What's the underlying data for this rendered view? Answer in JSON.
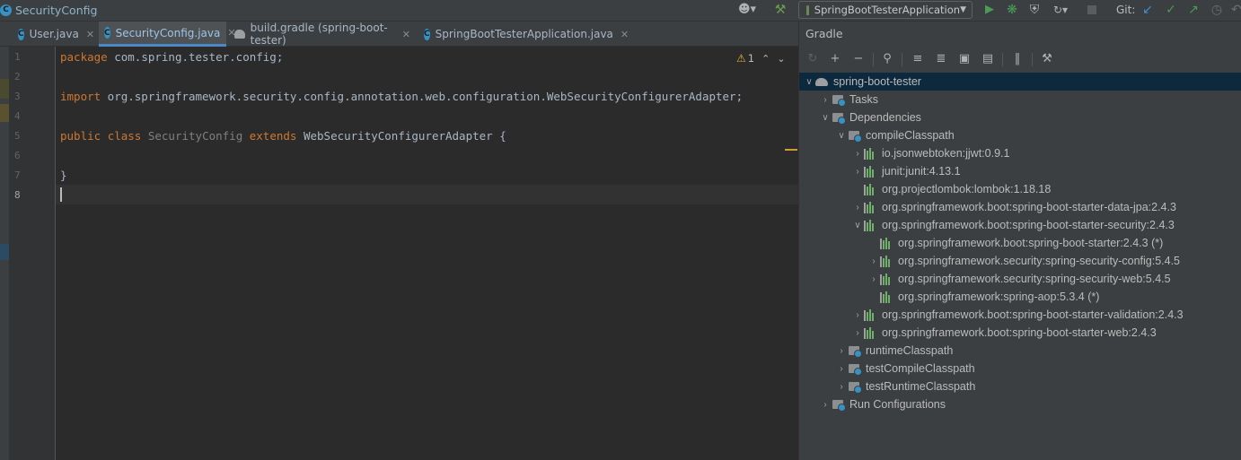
{
  "window": {
    "breadcrumb": "SecurityConfig"
  },
  "toolbar": {
    "run_config": "SpringBootTesterApplication",
    "git_label": "Git:"
  },
  "tabs": [
    {
      "label": "User.java",
      "icon": "java-class-icon"
    },
    {
      "label": "SecurityConfig.java",
      "icon": "java-class-icon",
      "active": true
    },
    {
      "label": "build.gradle (spring-boot-tester)",
      "icon": "gradle-icon"
    },
    {
      "label": "SpringBootTesterApplication.java",
      "icon": "java-class-icon"
    }
  ],
  "editor": {
    "line_numbers": [
      "1",
      "2",
      "3",
      "4",
      "5",
      "6",
      "7",
      "8"
    ],
    "current_line": "8",
    "inspection": {
      "warnings": "1"
    },
    "lines": {
      "l1": {
        "kw": "package",
        "rest": " com.spring.tester.config;"
      },
      "l3": {
        "kw": "import",
        "rest": " org.springframework.security.config.annotation.web.configuration.WebSecurityConfigurerAdapter;"
      },
      "l5": {
        "kw1": "public",
        "kw2": "class",
        "name": "SecurityConfig",
        "kw3": "extends",
        "parent": "WebSecurityConfigurerAdapter",
        "brace": "{"
      },
      "l7": {
        "brace": "}"
      }
    }
  },
  "gradle": {
    "title": "Gradle",
    "tree": [
      {
        "label": "spring-boot-tester"
      },
      {
        "label": "Tasks"
      },
      {
        "label": "Dependencies"
      },
      {
        "label": "compileClasspath"
      },
      {
        "label": "io.jsonwebtoken:jjwt:0.9.1"
      },
      {
        "label": "junit:junit:4.13.1"
      },
      {
        "label": "org.projectlombok:lombok:1.18.18"
      },
      {
        "label": "org.springframework.boot:spring-boot-starter-data-jpa:2.4.3"
      },
      {
        "label": "org.springframework.boot:spring-boot-starter-security:2.4.3"
      },
      {
        "label": "org.springframework.boot:spring-boot-starter:2.4.3 (*)"
      },
      {
        "label": "org.springframework.security:spring-security-config:5.4.5"
      },
      {
        "label": "org.springframework.security:spring-security-web:5.4.5"
      },
      {
        "label": "org.springframework:spring-aop:5.3.4 (*)"
      },
      {
        "label": "org.springframework.boot:spring-boot-starter-validation:2.4.3"
      },
      {
        "label": "org.springframework.boot:spring-boot-starter-web:2.4.3"
      },
      {
        "label": "runtimeClasspath"
      },
      {
        "label": "testCompileClasspath"
      },
      {
        "label": "testRuntimeClasspath"
      },
      {
        "label": "Run Configurations"
      }
    ]
  },
  "colors": {
    "keyword": "#cc7832",
    "selection": "#0d293e",
    "accent": "#4a88c7",
    "run_green": "#499c54"
  }
}
